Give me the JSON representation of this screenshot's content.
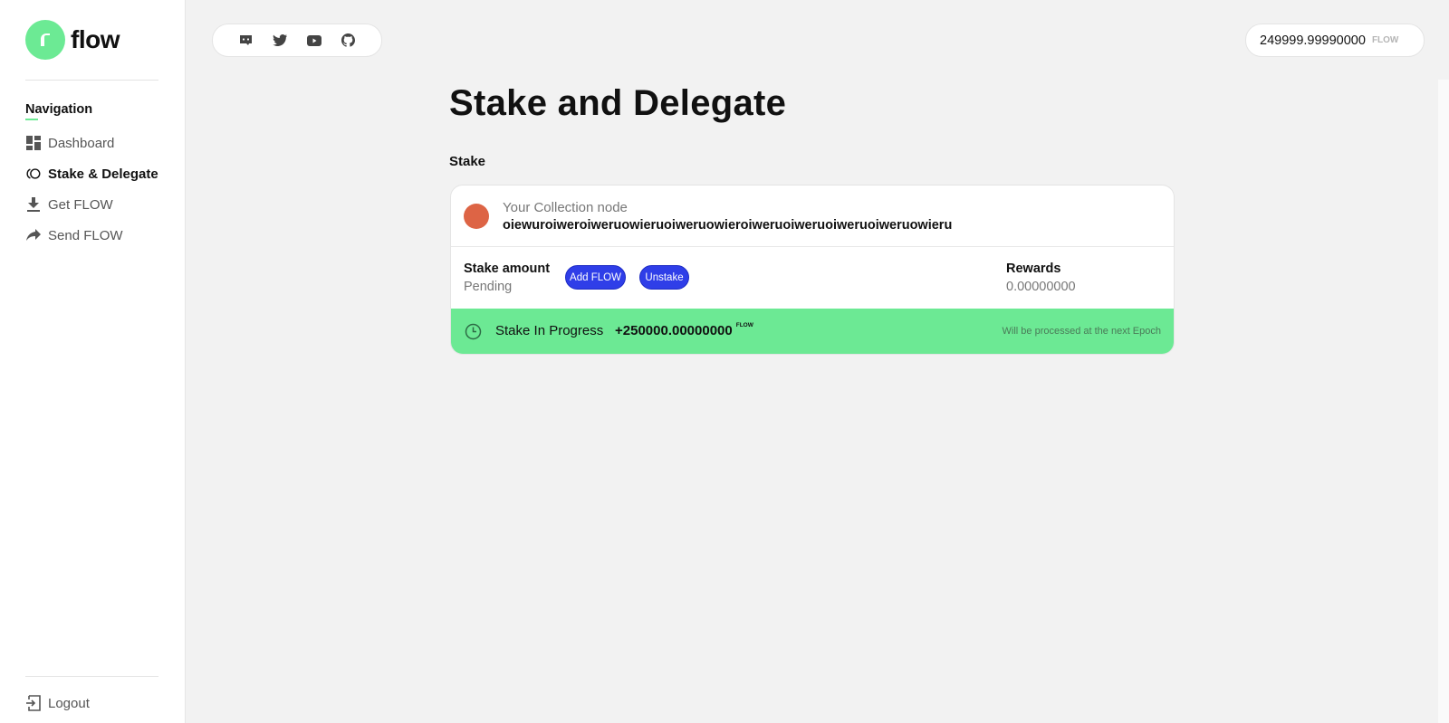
{
  "brand": {
    "name": "flow",
    "accent": "#6cea94"
  },
  "sidebar": {
    "heading": "Navigation",
    "items": [
      {
        "label": "Dashboard",
        "icon": "dashboard-icon",
        "active": false
      },
      {
        "label": "Stake & Delegate",
        "icon": "stake-icon",
        "active": true
      },
      {
        "label": "Get FLOW",
        "icon": "download-icon",
        "active": false
      },
      {
        "label": "Send FLOW",
        "icon": "share-arrow-icon",
        "active": false
      }
    ],
    "logout_label": "Logout"
  },
  "header": {
    "social_icons": [
      "discord-icon",
      "twitter-icon",
      "youtube-icon",
      "github-icon"
    ],
    "balance": {
      "value": "249999.99990000",
      "unit": "FLOW"
    }
  },
  "main": {
    "title": "Stake and Delegate",
    "section_label": "Stake",
    "node": {
      "label": "Your Collection node",
      "id": "oiewuroiweroiweruowieruoiweruowieroiweruoiweruoiweruoiweruowieru",
      "dot_color": "#dd6445"
    },
    "stake": {
      "label": "Stake amount",
      "status": "Pending",
      "add_button": "Add FLOW",
      "unstake_button": "Unstake",
      "button_color": "#2f3ee8"
    },
    "rewards": {
      "label": "Rewards",
      "value": "0.00000000"
    },
    "progress": {
      "label": "Stake In Progress",
      "amount": "+250000.00000000",
      "unit": "FLOW",
      "note": "Will be processed at the next Epoch",
      "color": "#6ce994"
    }
  }
}
